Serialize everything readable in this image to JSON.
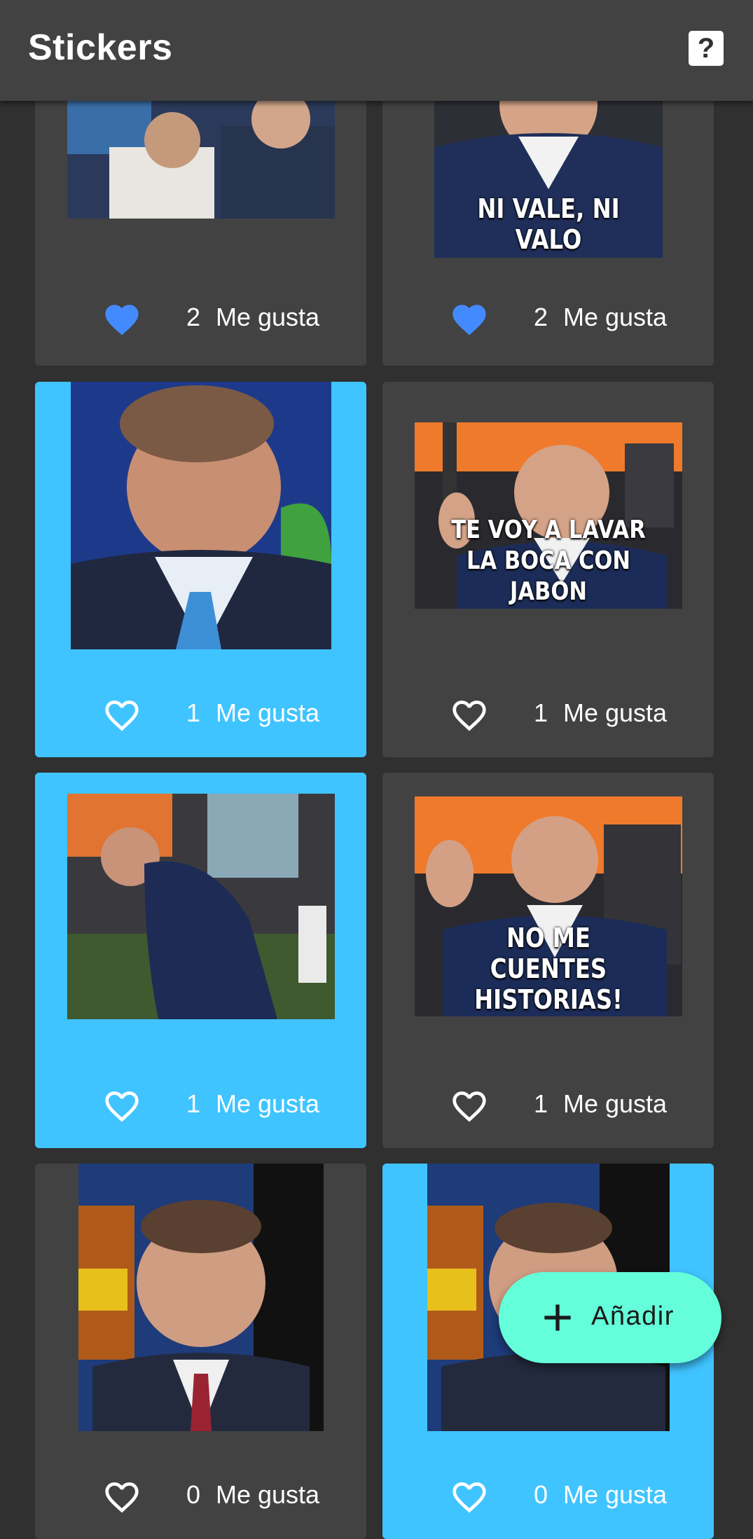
{
  "app": {
    "title": "Stickers",
    "help_icon": "help-icon"
  },
  "colors": {
    "selected": "#40c4ff",
    "liked": "#448aff",
    "fab": "#64ffda",
    "card": "#424242"
  },
  "like_label": "Me gusta",
  "stickers": [
    {
      "caption": "",
      "likes": "2",
      "liked": true,
      "selected": false
    },
    {
      "caption": "NI VALE, NI VALO",
      "likes": "2",
      "liked": true,
      "selected": false
    },
    {
      "caption": "",
      "likes": "1",
      "liked": false,
      "selected": true
    },
    {
      "caption": "TE VOY A LAVAR LA BOCA CON JABON",
      "likes": "1",
      "liked": false,
      "selected": false
    },
    {
      "caption": "",
      "likes": "1",
      "liked": false,
      "selected": true
    },
    {
      "caption": "NO ME CUENTES HISTORIAS!",
      "likes": "1",
      "liked": false,
      "selected": false
    },
    {
      "caption": "",
      "likes": "0",
      "liked": false,
      "selected": false
    },
    {
      "caption": "",
      "likes": "0",
      "liked": false,
      "selected": true
    }
  ],
  "fab": {
    "label": "Añadir",
    "icon": "plus-icon"
  }
}
